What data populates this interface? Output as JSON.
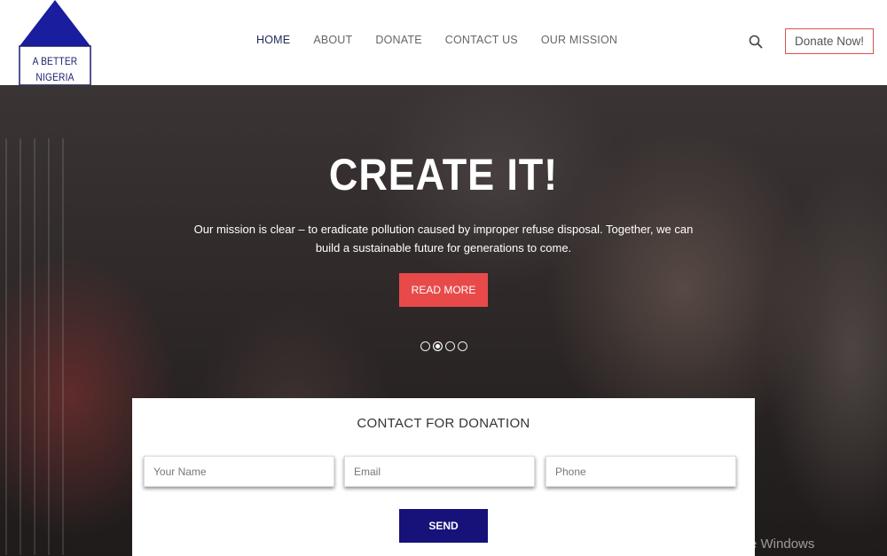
{
  "logo": {
    "line1": "A BETTER",
    "line2": "NIGERIA",
    "color": "#1a1d9e"
  },
  "nav": {
    "items": [
      "HOME",
      "ABOUT",
      "DONATE",
      "CONTACT US",
      "OUR MISSION"
    ],
    "active": "HOME"
  },
  "header": {
    "search_icon": "search-icon",
    "donate_label": "Donate Now!"
  },
  "hero": {
    "title": "CREATE IT!",
    "text": "Our mission is clear – to eradicate pollution caused by improper refuse disposal. Together, we can build a sustainable future for generations to come.",
    "read_more": "READ MORE",
    "slides": 4,
    "active_slide": 2,
    "button_color": "#e84a4a"
  },
  "contact": {
    "title": "CONTACT FOR DONATION",
    "name_placeholder": "Your Name",
    "email_placeholder": "Email",
    "phone_placeholder": "Phone",
    "send_label": "SEND",
    "send_color": "#16127a"
  },
  "watermark": "Activate Windows"
}
